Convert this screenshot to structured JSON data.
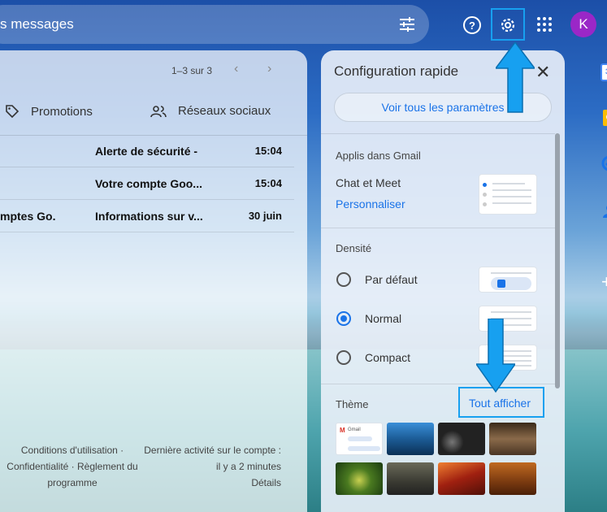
{
  "search": {
    "text": "s messages"
  },
  "header": {
    "icons": [
      "filter-icon",
      "help-icon",
      "gear-icon",
      "apps-icon"
    ],
    "avatar_initial": "K"
  },
  "mail": {
    "pagination": "1–3 sur 3",
    "tabs": [
      {
        "label": "Promotions",
        "icon": "tag-icon"
      },
      {
        "label": "Réseaux sociaux",
        "icon": "people-icon"
      }
    ],
    "rows": [
      {
        "sender": "",
        "subject": "Alerte de sécurité -",
        "date": "15:04"
      },
      {
        "sender": "",
        "subject": "Votre compte Goo...",
        "date": "15:04"
      },
      {
        "sender": "mptes Go.",
        "subject": "Informations sur v...",
        "date": "30 juin"
      }
    ],
    "footer_left": [
      "Conditions d'utilisation ·",
      "Confidentialité · Règlement du",
      "programme"
    ],
    "footer_right": [
      "Dernière activité sur le compte :",
      "il y a 2 minutes",
      "Détails"
    ]
  },
  "quick_settings": {
    "title": "Configuration rapide",
    "all_settings": "Voir tous les paramètres",
    "apps_section": "Applis dans Gmail",
    "apps_item": "Chat et Meet",
    "apps_link": "Personnaliser",
    "density_section": "Densité",
    "density_options": [
      {
        "label": "Par défaut",
        "checked": false
      },
      {
        "label": "Normal",
        "checked": true
      },
      {
        "label": "Compact",
        "checked": false
      }
    ],
    "theme_section": "Thème",
    "theme_link": "Tout afficher",
    "gmail_thumb_label": "Gmail"
  },
  "colors": {
    "accent": "#1a73e8",
    "highlight_box": "#17a0f0",
    "avatar": "#9a27c7"
  },
  "sidebar_icons": [
    "calendar-icon",
    "keep-icon",
    "tasks-icon",
    "contacts-icon",
    "add-icon"
  ],
  "calendar_date": "31"
}
